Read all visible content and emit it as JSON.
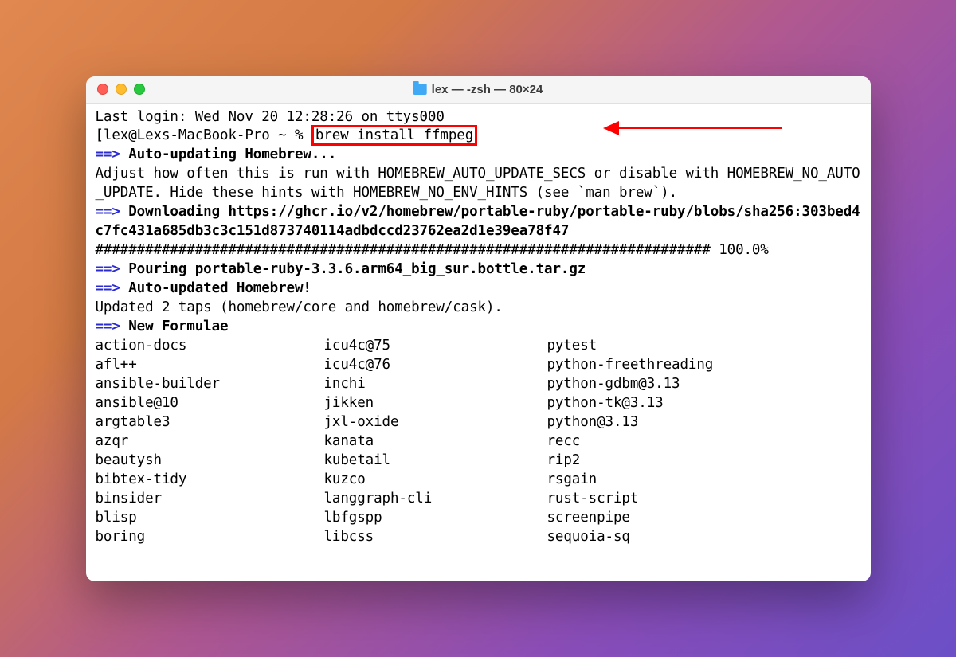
{
  "window": {
    "title": "lex — -zsh — 80×24"
  },
  "terminal": {
    "last_login": "Last login: Wed Nov 20 12:28:26 on ttys000",
    "prompt_prefix": "[lex@Lexs-MacBook-Pro ~ % ",
    "command": "brew install ffmpeg",
    "auto_update_header": "Auto-updating Homebrew...",
    "adjust_line": "Adjust how often this is run with HOMEBREW_AUTO_UPDATE_SECS or disable with HOMEBREW_NO_AUTO_UPDATE. Hide these hints with HOMEBREW_NO_ENV_HINTS (see `man brew`).",
    "downloading_header": "Downloading https://ghcr.io/v2/homebrew/portable-ruby/portable-ruby/blobs/sha256:303bed4c7fc431a685db3c3c151d873740114adbdccd23762ea2d1e39ea78f47",
    "progress_bar": "########################################################################## 100.0%",
    "pouring_header": "Pouring portable-ruby-3.3.6.arm64_big_sur.bottle.tar.gz",
    "updated_header": "Auto-updated Homebrew!",
    "updated_taps": "Updated 2 taps (homebrew/core and homebrew/cask).",
    "new_formulae_header": "New Formulae",
    "arrow": "==> ",
    "formulae": {
      "col1": [
        "action-docs",
        "afl++",
        "ansible-builder",
        "ansible@10",
        "argtable3",
        "azqr",
        "beautysh",
        "bibtex-tidy",
        "binsider",
        "blisp",
        "boring"
      ],
      "col2": [
        "icu4c@75",
        "icu4c@76",
        "inchi",
        "jikken",
        "jxl-oxide",
        "kanata",
        "kubetail",
        "kuzco",
        "langgraph-cli",
        "lbfgspp",
        "libcss"
      ],
      "col3": [
        "pytest",
        "python-freethreading",
        "python-gdbm@3.13",
        "python-tk@3.13",
        "python@3.13",
        "recc",
        "rip2",
        "rsgain",
        "rust-script",
        "screenpipe",
        "sequoia-sq"
      ]
    }
  }
}
